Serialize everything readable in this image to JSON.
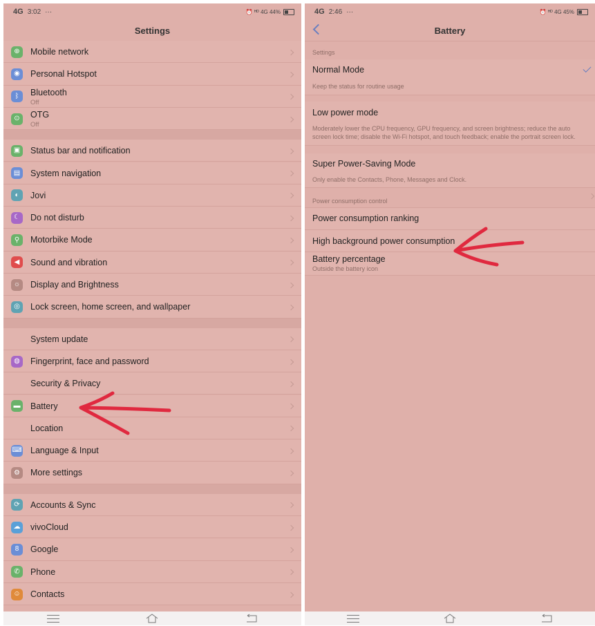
{
  "left": {
    "status": {
      "network": "4G",
      "time": "3:02",
      "dots": "···",
      "indicators": "⏰ ᴴᴰ 4G 44%"
    },
    "title": "Settings",
    "groups": [
      [
        {
          "label": "Mobile network",
          "icon": "globe-icon",
          "color": "#6ab26a",
          "glyph": "⊕"
        },
        {
          "label": "Personal Hotspot",
          "icon": "hotspot-icon",
          "color": "#6b8ed6",
          "glyph": "◉"
        },
        {
          "label": "Bluetooth",
          "sub": "Off",
          "icon": "bluetooth-icon",
          "color": "#6b8ed6",
          "glyph": "ᛒ"
        },
        {
          "label": "OTG",
          "sub": "Off",
          "icon": "otg-icon",
          "color": "#6ab26a",
          "glyph": "⊙"
        }
      ],
      [
        {
          "label": "Status bar and notification",
          "icon": "notification-icon",
          "color": "#6ab26a",
          "glyph": "▣"
        },
        {
          "label": "System navigation",
          "icon": "navigation-icon",
          "color": "#6b8ed6",
          "glyph": "▤"
        },
        {
          "label": "Jovi",
          "icon": "jovi-icon",
          "color": "#5fa3b3",
          "glyph": "◐"
        },
        {
          "label": "Do not disturb",
          "icon": "moon-icon",
          "color": "#a768c7",
          "glyph": "☾"
        },
        {
          "label": "Motorbike Mode",
          "icon": "motorbike-icon",
          "color": "#6ab26a",
          "glyph": "⚲"
        },
        {
          "label": "Sound and vibration",
          "icon": "sound-icon",
          "color": "#e04c4c",
          "glyph": "◀"
        },
        {
          "label": "Display and Brightness",
          "icon": "brightness-icon",
          "color": "#b58a83",
          "glyph": "☼"
        },
        {
          "label": "Lock screen, home screen, and wallpaper",
          "icon": "wallpaper-icon",
          "color": "#5fa3b3",
          "glyph": "◎"
        }
      ],
      [
        {
          "label": "System update",
          "icon": "",
          "color": "",
          "glyph": ""
        },
        {
          "label": "Fingerprint, face and password",
          "icon": "fingerprint-icon",
          "color": "#a768c7",
          "glyph": "◍"
        },
        {
          "label": "Security & Privacy",
          "icon": "",
          "color": "",
          "glyph": ""
        },
        {
          "label": "Battery",
          "icon": "battery-icon",
          "color": "#6ab26a",
          "glyph": "▬"
        },
        {
          "label": "Location",
          "icon": "",
          "color": "",
          "glyph": ""
        },
        {
          "label": "Language & Input",
          "icon": "keyboard-icon",
          "color": "#6b8ed6",
          "glyph": "⌨"
        },
        {
          "label": "More settings",
          "icon": "more-settings-icon",
          "color": "#b58a83",
          "glyph": "⚙"
        }
      ],
      [
        {
          "label": "Accounts & Sync",
          "icon": "sync-icon",
          "color": "#5fa3b3",
          "glyph": "⟳"
        },
        {
          "label": "vivoCloud",
          "icon": "cloud-icon",
          "color": "#5aa0d8",
          "glyph": "☁"
        },
        {
          "label": "Google",
          "icon": "google-icon",
          "color": "#6b8ed6",
          "glyph": "8"
        },
        {
          "label": "Phone",
          "icon": "phone-icon",
          "color": "#6ab26a",
          "glyph": "✆"
        },
        {
          "label": "Contacts",
          "icon": "contacts-icon",
          "color": "#e08a3a",
          "glyph": "☺"
        }
      ]
    ]
  },
  "right": {
    "status": {
      "network": "4G",
      "time": "2:46",
      "dots": "···",
      "indicators": "⏰ ᴴᴰ 4G 45%"
    },
    "title": "Battery",
    "settings_header": "Settings",
    "normal_mode": {
      "label": "Normal Mode",
      "desc": "Keep the status for routine usage",
      "selected": true
    },
    "low_power": {
      "label": "Low power mode",
      "desc": "Moderately lower the CPU frequency, GPU frequency, and screen brightness; reduce the auto screen lock time; disable the Wi-Fi hotspot, and touch feedback; enable the portrait screen lock."
    },
    "super_saving": {
      "label": "Super Power-Saving Mode",
      "desc": "Only enable the Contacts, Phone, Messages and Clock."
    },
    "power_header": "Power consumption control",
    "ranking": {
      "label": "Power consumption ranking"
    },
    "background": {
      "label": "High background power consumption"
    },
    "percentage": {
      "label": "Battery percentage",
      "sub": "Outside the battery icon"
    }
  },
  "annotation_color": "#e0293f"
}
